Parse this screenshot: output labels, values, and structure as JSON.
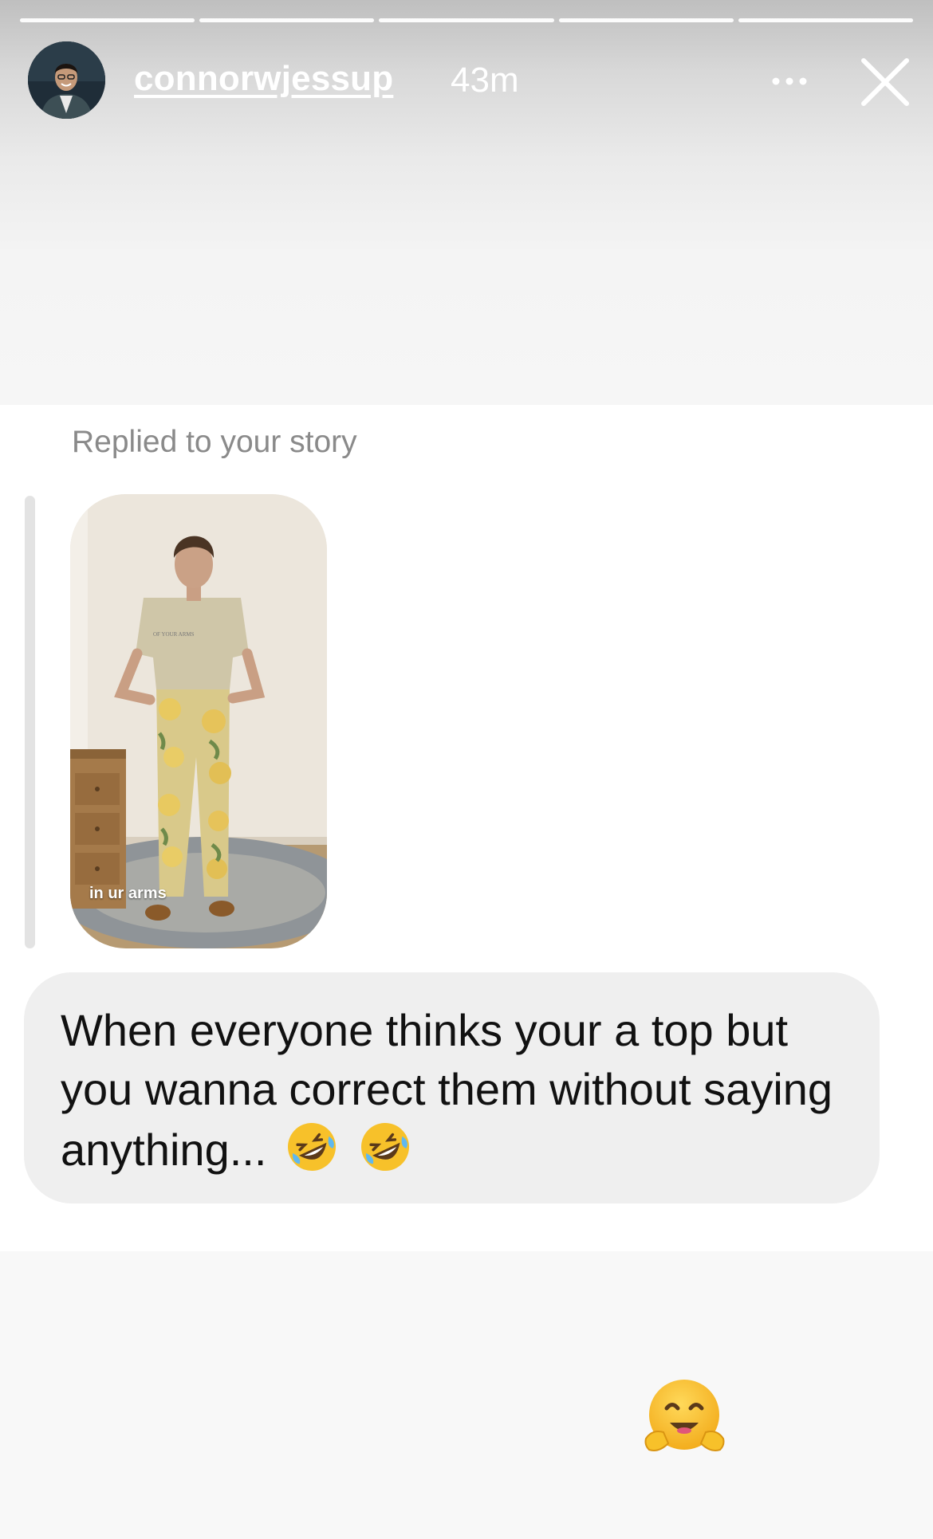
{
  "story": {
    "username": "connorwjessup",
    "timestamp": "43m",
    "progress_segments": 5
  },
  "icons": {
    "more": "more-options-icon",
    "close": "close-icon",
    "emoji_in_message": "rolling-on-floor-laughing-emoji",
    "reaction": "hugging-face-emoji"
  },
  "reply": {
    "label": "Replied to your story",
    "thumbnail_caption": "in ur arms",
    "shirt_text": "OF YOUR ARMS",
    "message": "When everyone thinks your a top but you wanna correct them without saying anything..."
  },
  "colors": {
    "bubble": "#efefef",
    "label_gray": "#8a8a8a",
    "quote_bar": "#e3e3e3",
    "emoji_yellow": "#f7c12a"
  }
}
